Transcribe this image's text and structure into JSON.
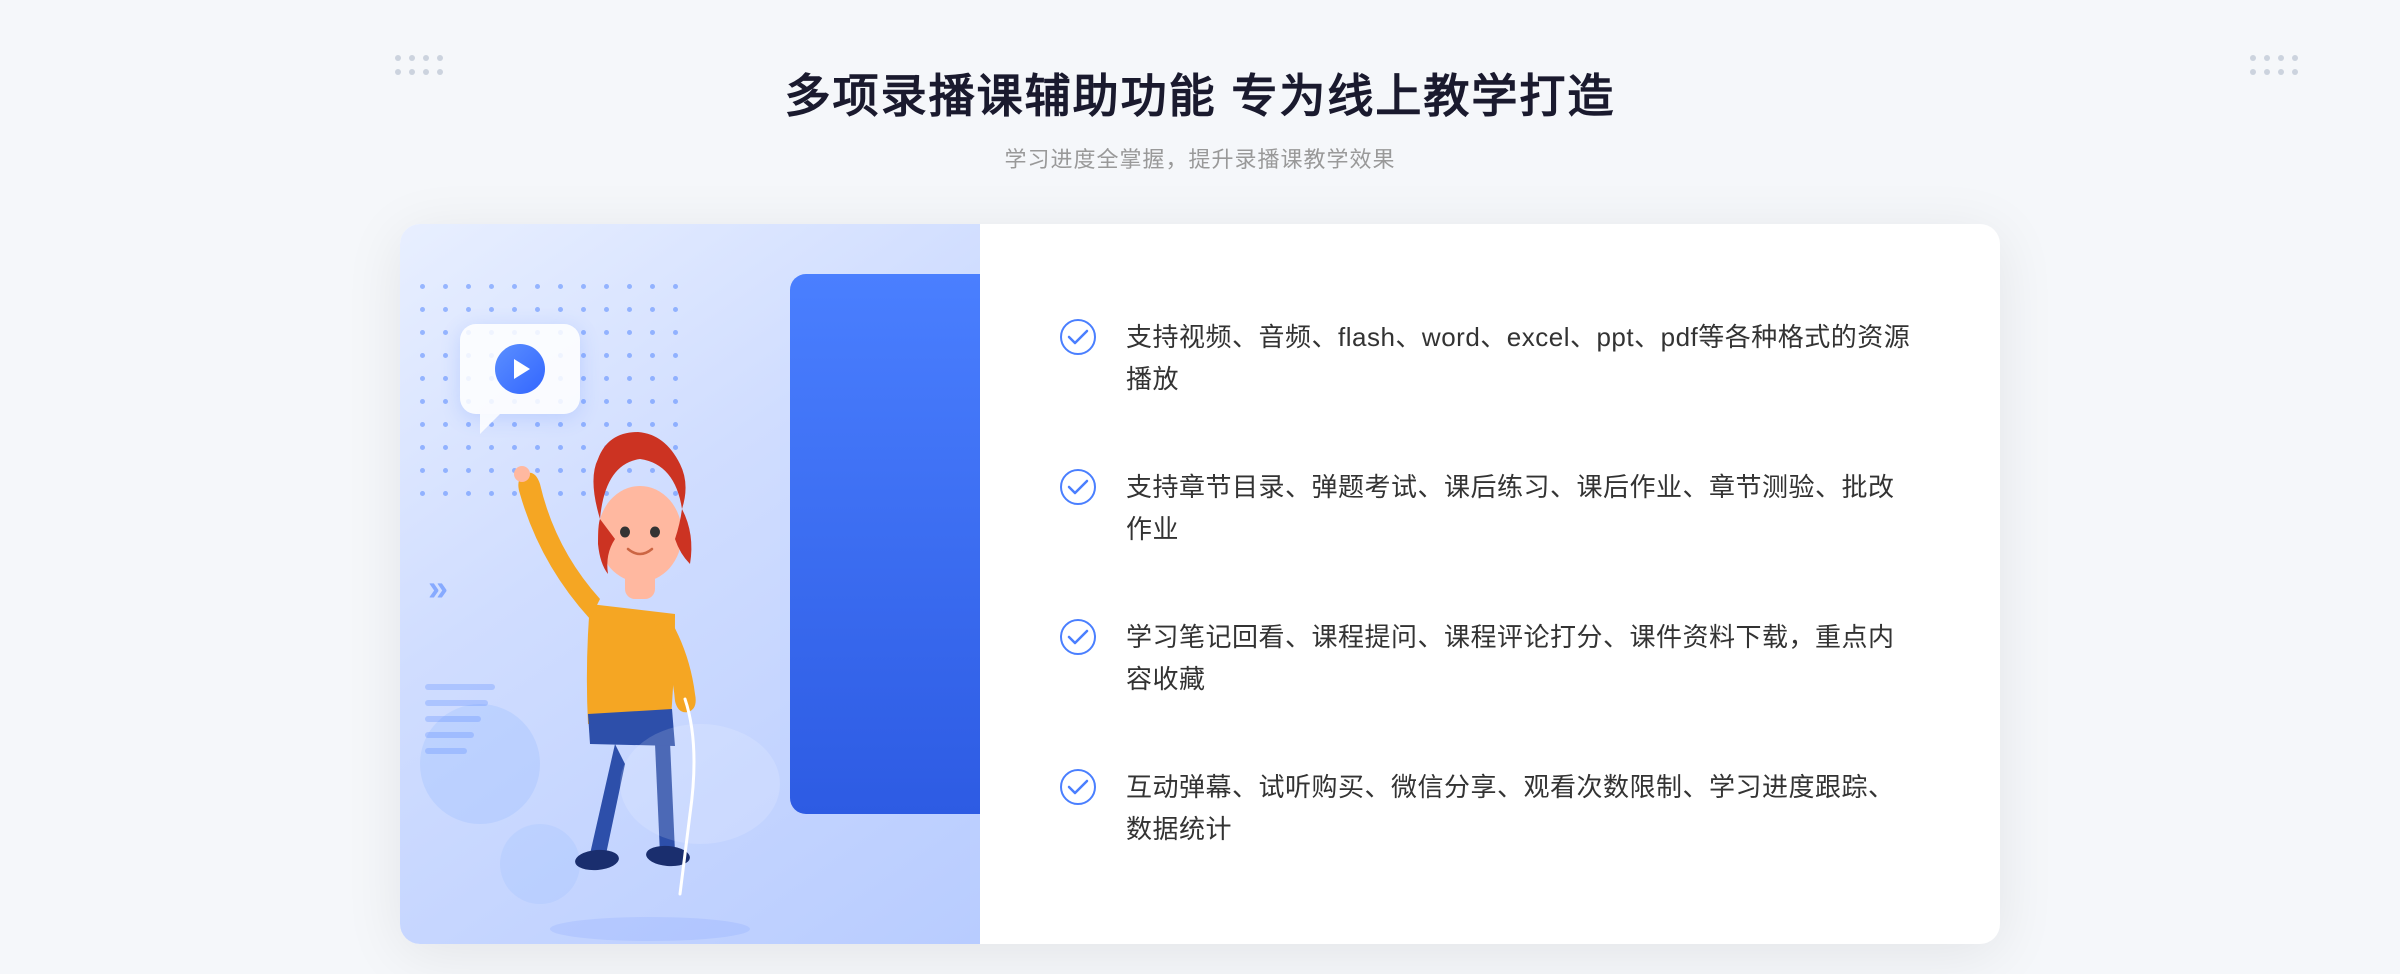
{
  "header": {
    "title": "多项录播课辅助功能 专为线上教学打造",
    "subtitle": "学习进度全掌握，提升录播课教学效果"
  },
  "features": [
    {
      "id": 1,
      "text": "支持视频、音频、flash、word、excel、ppt、pdf等各种格式的资源播放"
    },
    {
      "id": 2,
      "text": "支持章节目录、弹题考试、课后练习、课后作业、章节测验、批改作业"
    },
    {
      "id": 3,
      "text": "学习笔记回看、课程提问、课程评论打分、课件资料下载，重点内容收藏"
    },
    {
      "id": 4,
      "text": "互动弹幕、试听购买、微信分享、观看次数限制、学习进度跟踪、数据统计"
    }
  ],
  "colors": {
    "primary": "#3d6fff",
    "primaryLight": "#5b8fff",
    "background": "#f5f7fa",
    "text_dark": "#1a1a2e",
    "text_medium": "#333333",
    "text_light": "#999999",
    "accent_blue": "#4a7fff",
    "gradient_start": "#e8efff",
    "gradient_end": "#b8ccff"
  },
  "decorations": {
    "play_icon": "▶",
    "check_icon": "✓",
    "arrow_left": "«",
    "arrow_right": "«"
  }
}
